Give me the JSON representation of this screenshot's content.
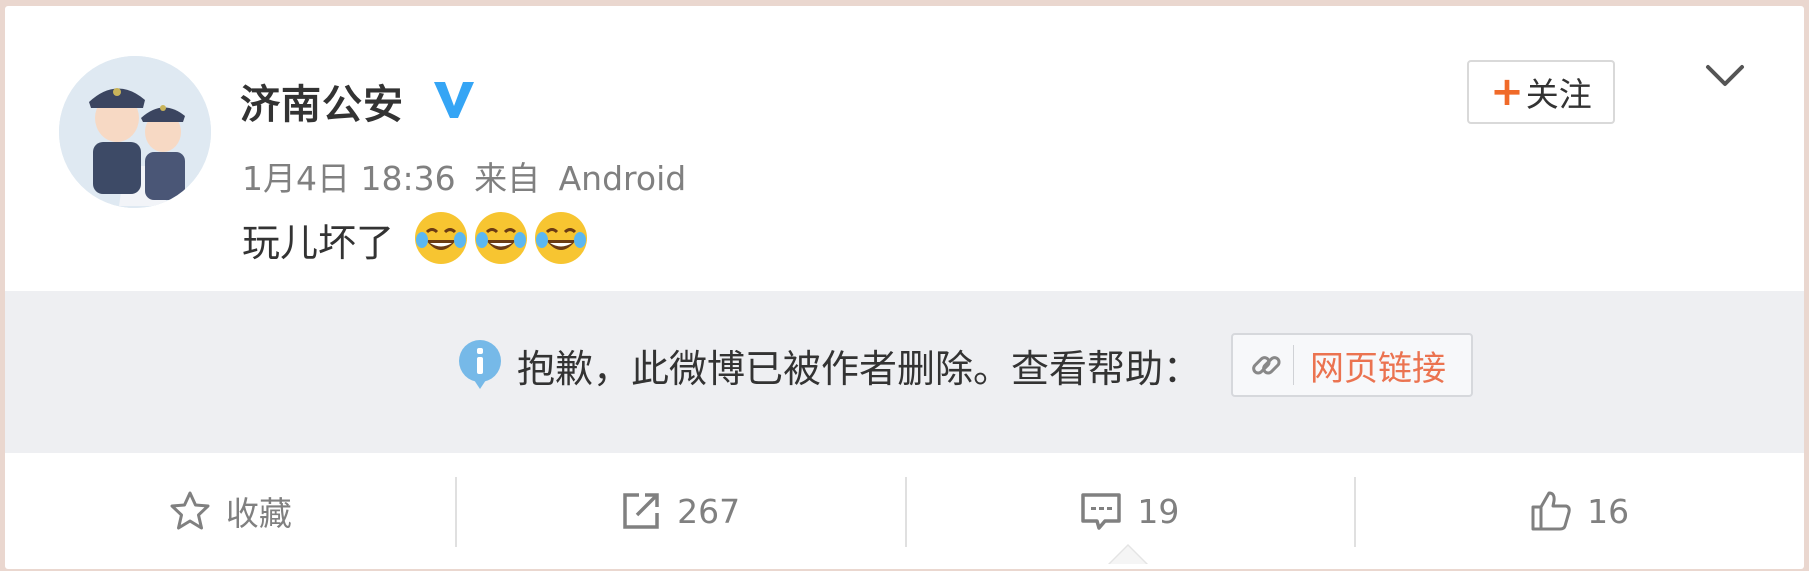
{
  "post": {
    "author": "济南公安",
    "verified_badge": "V",
    "date": "1月4日 18:36",
    "source_prefix": "来自",
    "source": "Android",
    "text": "玩儿坏了",
    "emojis": [
      "crying-laughing-emoji",
      "crying-laughing-emoji",
      "crying-laughing-emoji"
    ]
  },
  "follow_button": {
    "plus": "+",
    "label": "关注"
  },
  "deleted_notice": {
    "icon": "info-icon",
    "message": "抱歉，此微博已被作者删除。查看帮助：",
    "link_label": "网页链接"
  },
  "actions": {
    "favorite": {
      "icon": "star-icon",
      "label": "收藏"
    },
    "repost": {
      "icon": "share-icon",
      "count": "267"
    },
    "comment": {
      "icon": "comment-icon",
      "count": "19"
    },
    "like": {
      "icon": "thumbs-up-icon",
      "count": "16"
    }
  },
  "colors": {
    "accent_orange": "#f06a29",
    "link_color": "#eb7350",
    "verified_blue": "#35a5f5",
    "muted_text": "#808080"
  }
}
